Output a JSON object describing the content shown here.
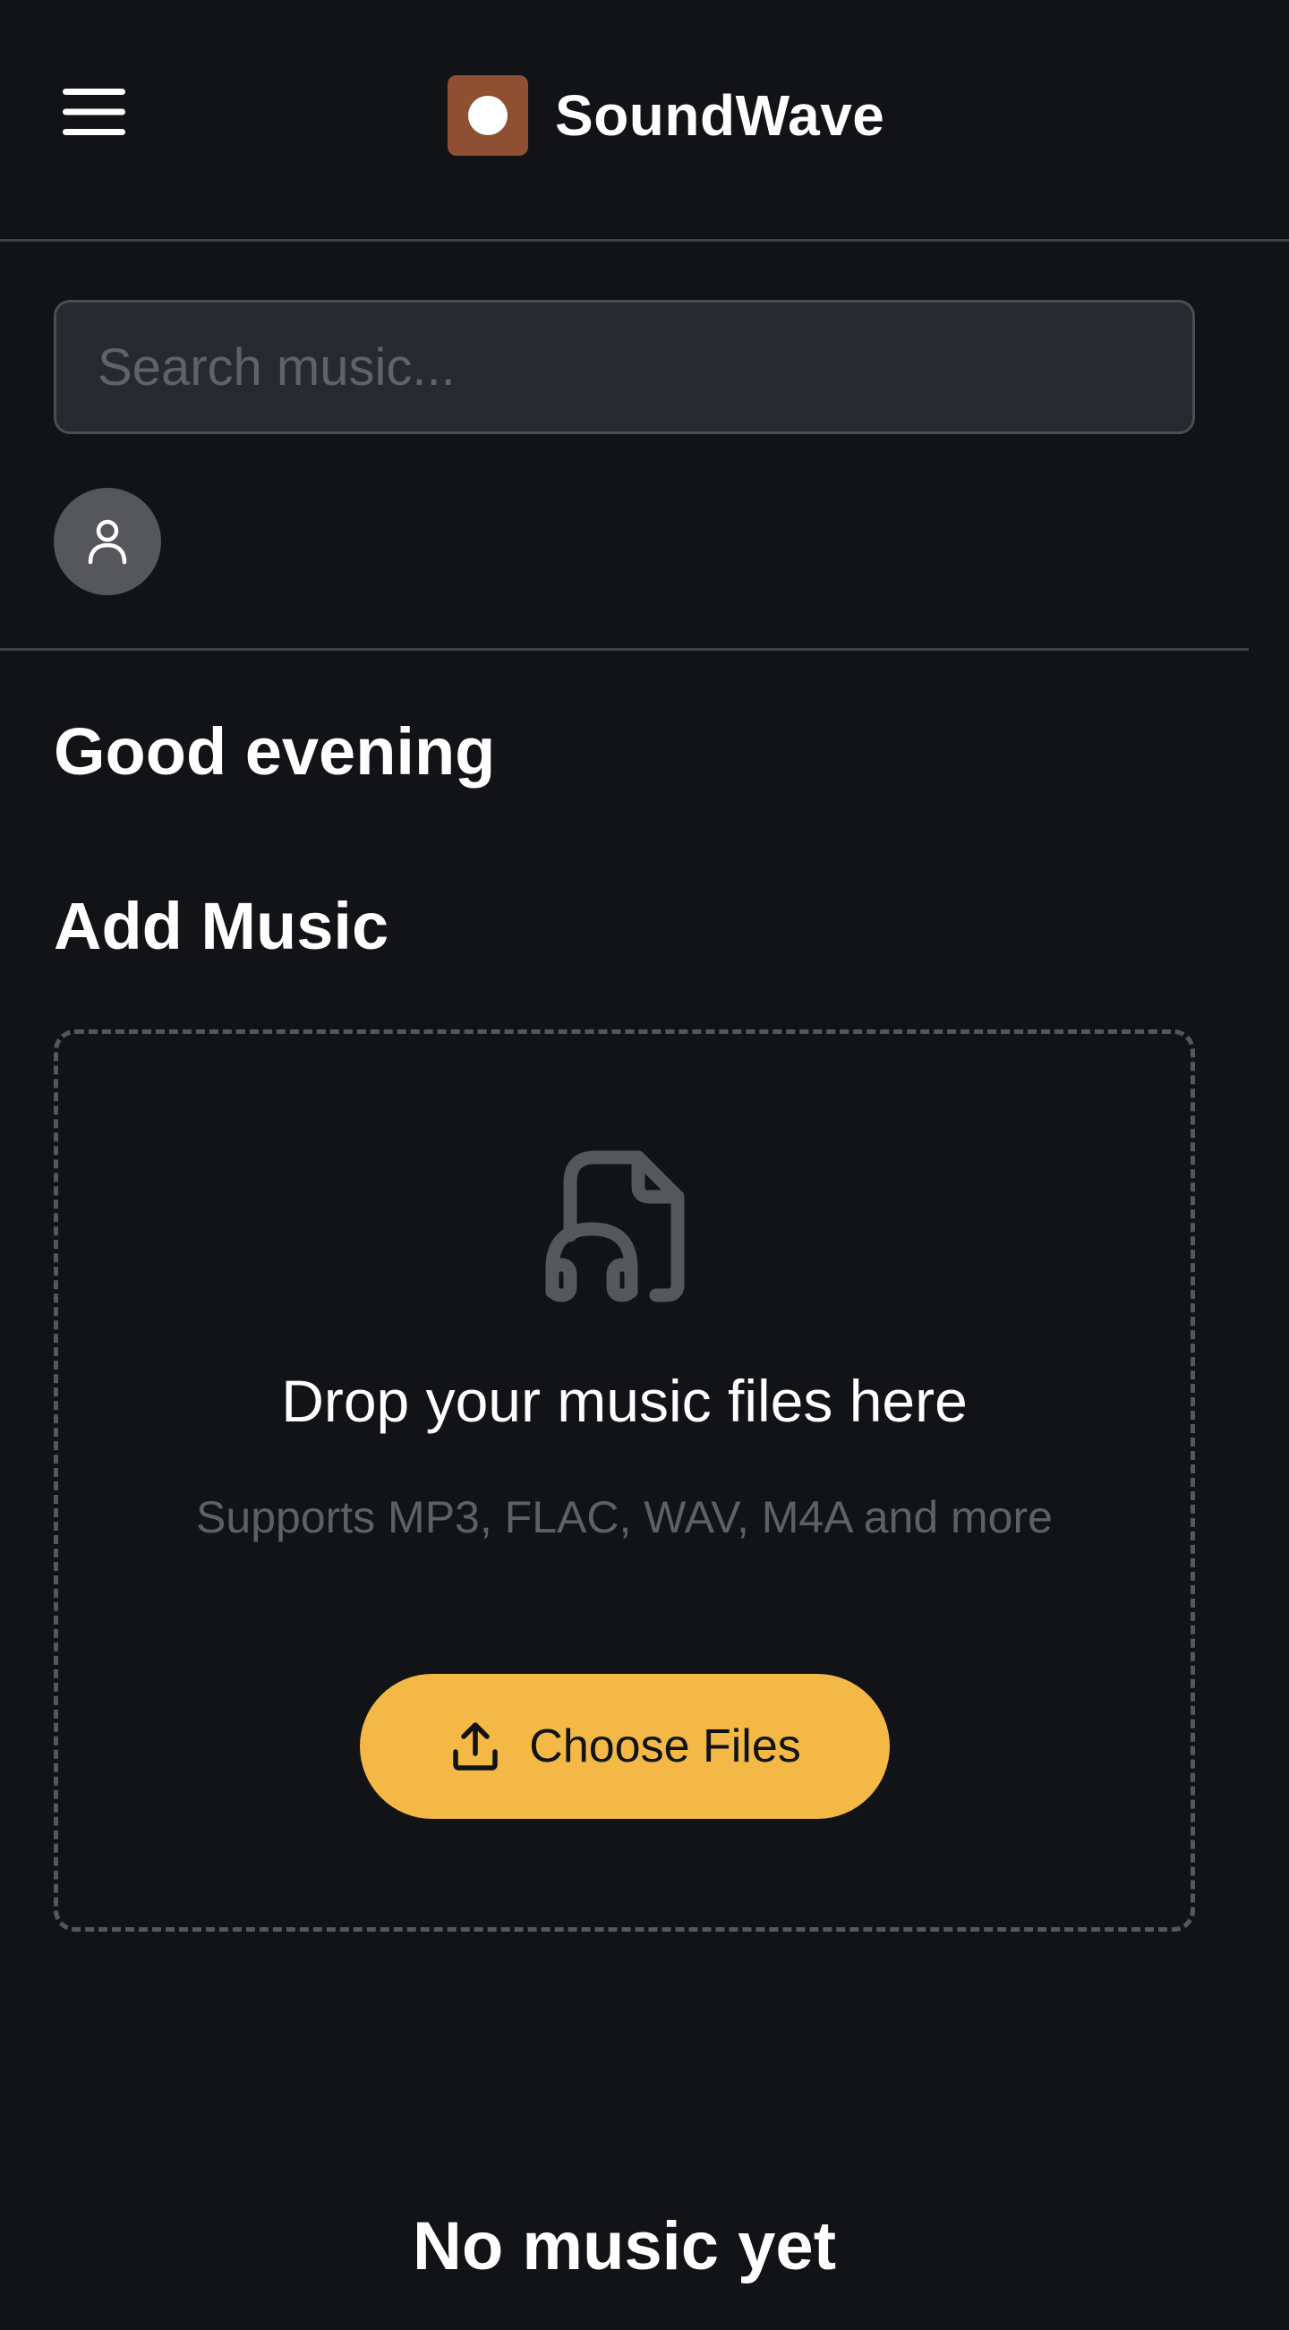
{
  "app": {
    "brand_name": "SoundWave",
    "brand_color": "#8e4f33",
    "accent_color": "#f3b846",
    "background_color": "#111317"
  },
  "header": {
    "menu_icon": "hamburger-menu-icon",
    "logo_icon": "record-dot-icon"
  },
  "search": {
    "placeholder": "Search music...",
    "value": ""
  },
  "profile": {
    "icon": "user-icon"
  },
  "main": {
    "greeting": "Good evening",
    "add_music_title": "Add Music",
    "dropzone": {
      "icon": "music-file-icon",
      "title": "Drop your music files here",
      "subtitle": "Supports MP3, FLAC, WAV, M4A and more",
      "button_label": "Choose Files",
      "button_icon": "upload-icon"
    },
    "empty_state_title": "No music yet"
  }
}
